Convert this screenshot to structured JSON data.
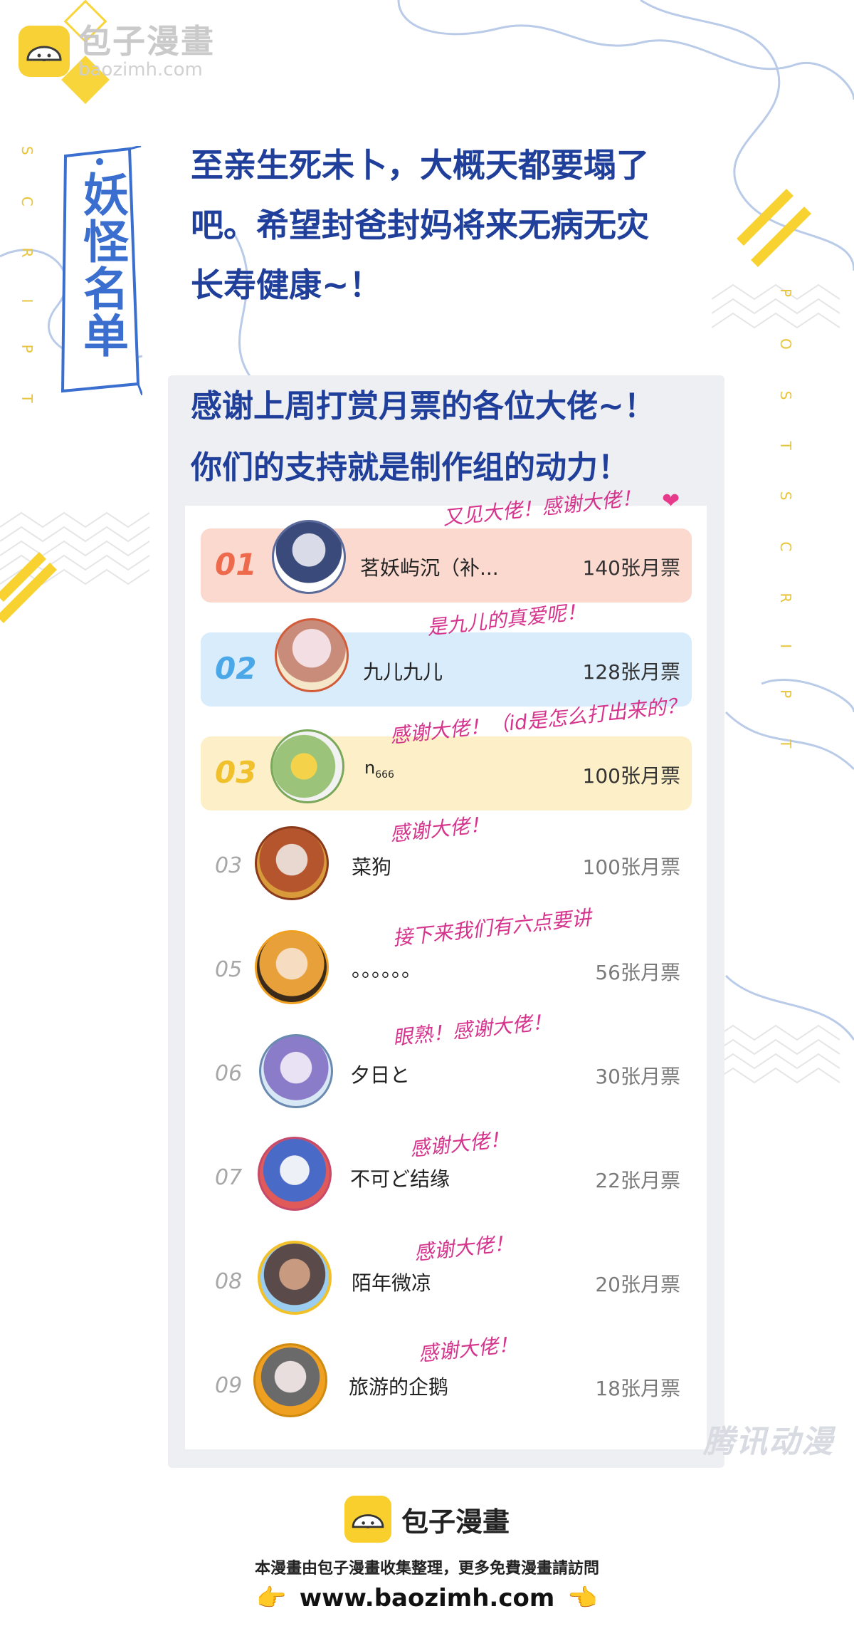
{
  "watermark": {
    "name": "包子漫畫",
    "url": "baozimh.com"
  },
  "side_title": "妖怪名单",
  "side_words": {
    "left": "SCRIPT",
    "right": "POSTSCRIPT"
  },
  "intro": {
    "lines": [
      "至亲生死未卜，大概天都要塌了",
      "吧。希望封爸封妈将来无病无灾",
      "长寿健康~！"
    ]
  },
  "thanks": {
    "lines": [
      "感谢上周打赏月票的各位大佬~！",
      "你们的支持就是制作组的动力！"
    ]
  },
  "ranking": [
    {
      "rank": "01",
      "name": "茗妖屿沉（补...",
      "votes": "140张月票",
      "note": "又见大佬！感谢大佬！"
    },
    {
      "rank": "02",
      "name": "九儿九儿",
      "votes": "128张月票",
      "note": "是九儿的真爱呢！"
    },
    {
      "rank": "03",
      "name": "n",
      "name_sub": "666",
      "votes": "100张月票",
      "note": "感谢大佬！（id是怎么打出来的？"
    },
    {
      "rank": "03",
      "name": "菜狗",
      "votes": "100张月票",
      "note": "感谢大佬！"
    },
    {
      "rank": "05",
      "name": "。。。。。。",
      "votes": "56张月票",
      "note": "接下来我们有六点要讲"
    },
    {
      "rank": "06",
      "name": "夕日と",
      "votes": "30张月票",
      "note": "眼熟！感谢大佬！"
    },
    {
      "rank": "07",
      "name": "不可ど结缘",
      "votes": "22张月票",
      "note": "感谢大佬！"
    },
    {
      "rank": "08",
      "name": "陌年微凉",
      "votes": "20张月票",
      "note": "感谢大佬！"
    },
    {
      "rank": "09",
      "name": "旅游的企鹅",
      "votes": "18张月票",
      "note": "感谢大佬！"
    }
  ],
  "colors": {
    "row1": "#fbd9cf",
    "row2": "#d9ecfb",
    "row3": "#fdf0c8",
    "rank1": "#ee6a4d",
    "rank2": "#4aa7e8",
    "rank3": "#f0c12d",
    "note": "#d6338d",
    "heading": "#1f3f9a"
  },
  "corner_mark": "腾讯动漫",
  "footer": {
    "name": "包子漫畫",
    "line": "本漫畫由包子漫畫收集整理，更多免費漫畫請訪問",
    "url": "www.baozimh.com"
  }
}
